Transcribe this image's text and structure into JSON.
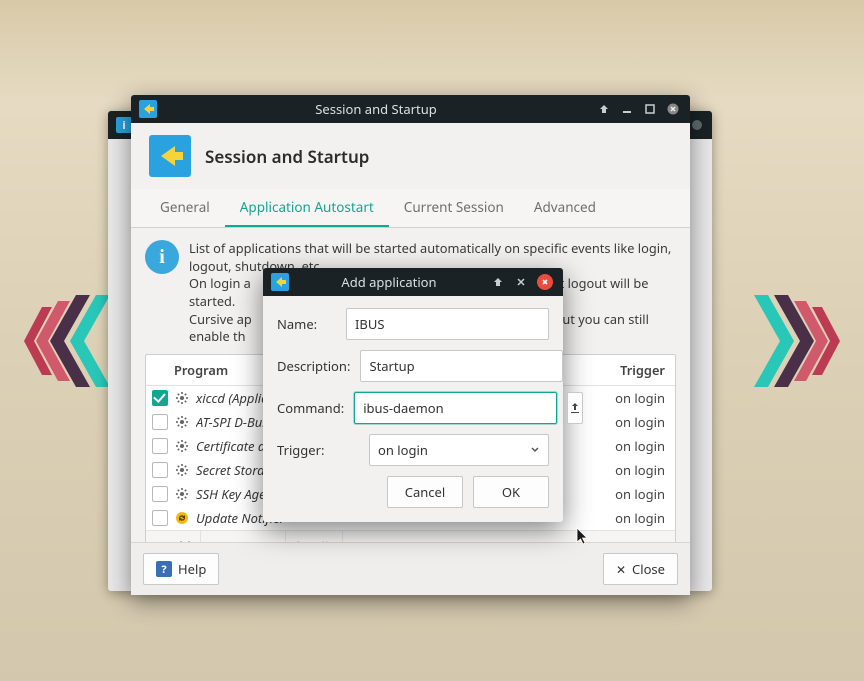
{
  "window": {
    "titlebar": "Session and Startup",
    "header_title": "Session and Startup"
  },
  "tabs": {
    "general": "General",
    "autostart": "Application Autostart",
    "current": "Current Session",
    "advanced": "Advanced"
  },
  "info": {
    "line1": "List of applications that will be started automatically on specific events like login, logout, shutdown, etc.",
    "line2a": "On login a",
    "line2b": "st logout will be started.",
    "line3a": "Cursive ap",
    "line3b": "but you can still enable th"
  },
  "list": {
    "col_program": "Program",
    "col_trigger": "Trigger",
    "rows": [
      {
        "checked": true,
        "icon": "gear",
        "label": "xiccd (Applie",
        "trigger": "on login"
      },
      {
        "checked": false,
        "icon": "gear",
        "label": "AT-SPI D-Bus",
        "trigger": "on login"
      },
      {
        "checked": false,
        "icon": "gear",
        "label": "Certificate ar",
        "trigger": "on login"
      },
      {
        "checked": false,
        "icon": "gear",
        "label": "Secret Storag",
        "trigger": "on login"
      },
      {
        "checked": false,
        "icon": "gear",
        "label": "SSH Key Agent (GNOME Keyring: SSH Agent)",
        "trigger": "on login"
      },
      {
        "checked": false,
        "icon": "update",
        "label": "Update Notifier",
        "trigger": "on login"
      }
    ]
  },
  "list_actions": {
    "add": "Add",
    "remove": "Remove",
    "edit": "Edit"
  },
  "footer": {
    "help": "Help",
    "close": "Close"
  },
  "dialog": {
    "title": "Add application",
    "name_label": "Name:",
    "name_value": "IBUS",
    "desc_label": "Description:",
    "desc_value": "Startup",
    "cmd_label": "Command:",
    "cmd_value": "ibus-daemon",
    "trigger_label": "Trigger:",
    "trigger_value": "on login",
    "cancel": "Cancel",
    "ok": "OK"
  }
}
